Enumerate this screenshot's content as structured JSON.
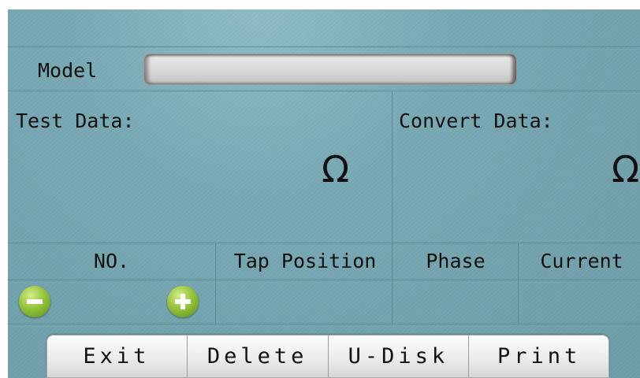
{
  "model": {
    "label": "Model",
    "value": ""
  },
  "test_data": {
    "label": "Test Data:",
    "value": "",
    "unit": "Ω"
  },
  "convert_data": {
    "label": "Convert Data:",
    "value": "",
    "unit": "Ω"
  },
  "table": {
    "headers": [
      "NO.",
      "Tap Position",
      "Phase",
      "Current"
    ],
    "row": {
      "no": "",
      "tap_position": "",
      "phase": "",
      "current": ""
    }
  },
  "controls": {
    "decrement_icon": "minus-circle-icon",
    "increment_icon": "plus-circle-icon"
  },
  "buttons": [
    "Exit",
    "Delete",
    "U-Disk",
    "Print"
  ],
  "colors": {
    "background": "#78a9b4",
    "button_green": "#96c43c",
    "text": "#111111"
  }
}
